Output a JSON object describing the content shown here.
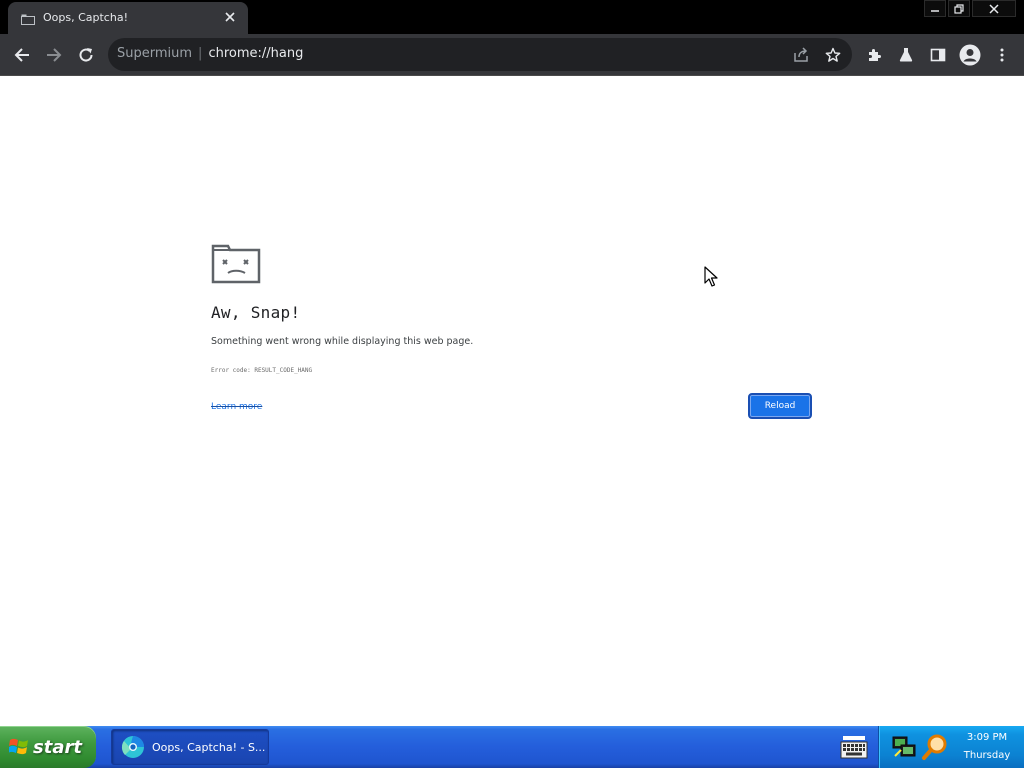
{
  "browser": {
    "tab_title": "Oops, Captcha!",
    "omnibox": {
      "site": "Supermium",
      "url": "chrome://hang"
    }
  },
  "error_page": {
    "heading": "Aw, Snap!",
    "description": "Something went wrong while displaying this web page.",
    "error_code": "Error code: RESULT_CODE_HANG",
    "learn_more": "Learn more",
    "reload_label": "Reload"
  },
  "taskbar": {
    "start_label": "start",
    "task_label": "Oops, Captcha! - S...",
    "clock_time": "3:09 PM",
    "clock_day": "Thursday"
  },
  "colors": {
    "accent": "#1a73e8",
    "toolbar": "#35363a",
    "omnibox": "#202124",
    "taskbar": "#245edb",
    "start_green": "#3f9a3f"
  },
  "icons": [
    "sad-tab-icon",
    "back-icon",
    "forward-icon",
    "reload-icon",
    "share-icon",
    "star-icon",
    "extensions-icon",
    "labs-icon",
    "side-panel-icon",
    "profile-icon",
    "menu-icon",
    "windows-logo-icon",
    "keyboard-icon",
    "network-icon",
    "search-icon"
  ]
}
